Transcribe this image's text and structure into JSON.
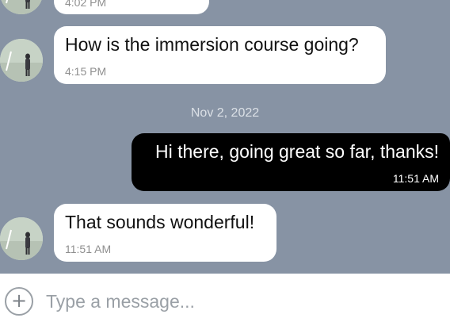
{
  "chat": {
    "background_color": "#8793a4",
    "previous_message": {
      "time": "4:02 PM"
    },
    "messages": [
      {
        "sender": "incoming",
        "text": "How is the immersion course going?",
        "time": "4:15 PM"
      },
      {
        "sender": "outgoing",
        "text": "Hi there, going great so far, thanks!",
        "time": "11:51 AM"
      },
      {
        "sender": "incoming",
        "text": "That sounds wonderful!",
        "time": "11:51 AM"
      }
    ],
    "date_divider": "Nov 2, 2022",
    "contact_avatar_icon": "avatar-photo-icon"
  },
  "composer": {
    "add_icon": "plus-circle-icon",
    "placeholder": "Type a message...",
    "value": ""
  },
  "colors": {
    "incoming_bubble": "#ffffff",
    "outgoing_bubble": "#000000",
    "timestamp_incoming": "#8f8f8f"
  }
}
